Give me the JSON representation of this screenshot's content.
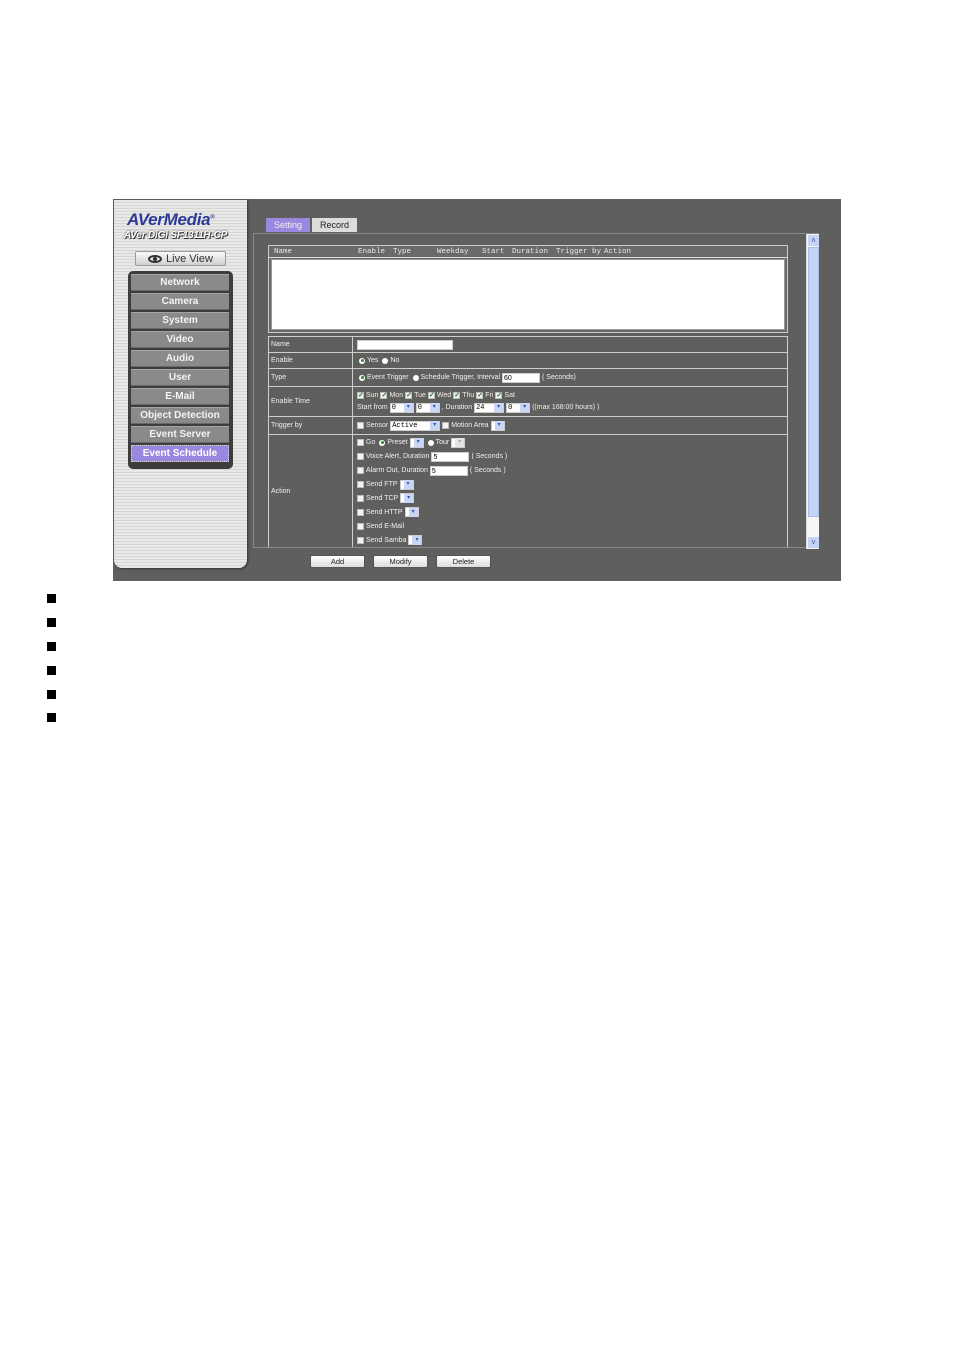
{
  "sidebar": {
    "brand": "AVerMedia",
    "model": "AVer DiGi SF1311H-CP",
    "live_view_label": "Live View",
    "menu": [
      {
        "label": "Network"
      },
      {
        "label": "Camera"
      },
      {
        "label": "System"
      },
      {
        "label": "Video"
      },
      {
        "label": "Audio"
      },
      {
        "label": "User"
      },
      {
        "label": "E-Mail"
      },
      {
        "label": "Object Detection"
      },
      {
        "label": "Event Server"
      },
      {
        "label": "Event Schedule",
        "active": true
      }
    ]
  },
  "tabs": [
    {
      "label": "Setting",
      "active": true
    },
    {
      "label": "Record",
      "active": false
    }
  ],
  "list": {
    "columns": [
      "Name",
      "Enable",
      "Type",
      "Weekday",
      "Start",
      "Duration",
      "Trigger by",
      "Action"
    ],
    "rows": []
  },
  "form": {
    "name": {
      "label": "Name",
      "value": ""
    },
    "enable": {
      "label": "Enable",
      "options": [
        "Yes",
        "No"
      ],
      "selected": "Yes"
    },
    "type": {
      "label": "Type",
      "options": [
        "Event Trigger",
        "Schedule Trigger, Interval"
      ],
      "selected": "Event Trigger",
      "interval_value": "60",
      "interval_unit": "( Seconds)"
    },
    "enable_time": {
      "label": "Enable Time",
      "days": [
        {
          "label": "Sun",
          "checked": true
        },
        {
          "label": "Mon",
          "checked": true
        },
        {
          "label": "Tue",
          "checked": true
        },
        {
          "label": "Wed",
          "checked": true
        },
        {
          "label": "Thu",
          "checked": true
        },
        {
          "label": "Fri",
          "checked": true
        },
        {
          "label": "Sat",
          "checked": true
        }
      ],
      "start_from_label": "Start from",
      "start_hour": "0",
      "start_minute": "0",
      "duration_label": ", Duration",
      "duration_hour": "24",
      "duration_minute": "0",
      "max_note": "((max 168:00 hours) )"
    },
    "trigger_by": {
      "label": "Trigger by",
      "sensor_label": "Sensor",
      "sensor_checked": false,
      "sensor_value": "Active",
      "motion_label": "Motion Area",
      "motion_checked": false,
      "motion_value": ""
    },
    "action": {
      "label": "Action",
      "go_label": "Go",
      "preset_label": "Preset",
      "tour_label": "Tour",
      "voice_alert_label": "Voice Alert, Duration",
      "voice_alert_value": "5",
      "alarm_out_label": "Alarm Out, Duration",
      "alarm_out_value": "5",
      "seconds_label": "( Seconds )",
      "send_ftp_label": "Send FTP",
      "send_tcp_label": "Send TCP",
      "send_http_label": "Send HTTP",
      "send_email_label": "Send E-Mail",
      "send_samba_label": "Send Samba"
    }
  },
  "buttons": {
    "add": "Add",
    "modify": "Modify",
    "delete": "Delete"
  },
  "document": {
    "bullet_count": 6
  }
}
